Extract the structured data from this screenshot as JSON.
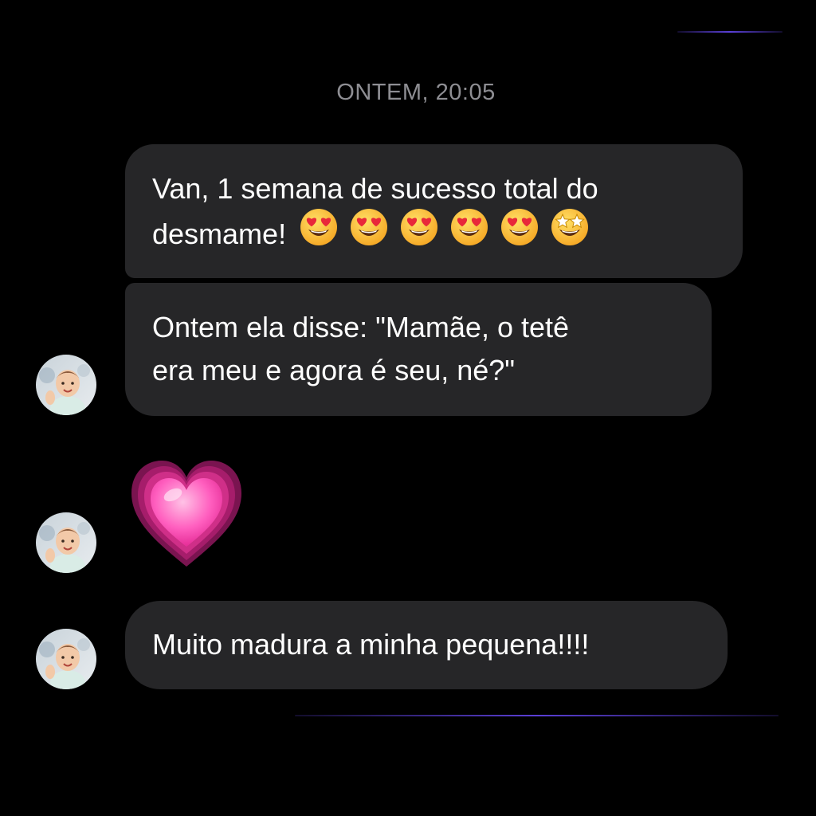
{
  "colors": {
    "background": "#000000",
    "bubble": "#262628",
    "text": "#ffffff",
    "timestamp": "#8e8e93",
    "accent_line": "#5a3fd6",
    "heart": "#ff4fb0"
  },
  "chat": {
    "timestamp": "ONTEM, 20:05",
    "messages": [
      {
        "line1": "Van, 1 semana de sucesso total do",
        "line2": "desmame!",
        "emojis": [
          "heart-eyes-emoji",
          "heart-eyes-emoji",
          "heart-eyes-emoji",
          "heart-eyes-emoji",
          "heart-eyes-emoji",
          "star-struck-emoji"
        ]
      },
      {
        "line1": "Ontem ela disse: \"Mamãe, o tetê",
        "line2": "era meu e agora é seu, né?\""
      },
      {
        "emoji": "growing-heart-emoji"
      },
      {
        "text": "Muito madura a minha pequena!!!!"
      }
    ],
    "sender_avatar": "baby-photo-avatar"
  }
}
